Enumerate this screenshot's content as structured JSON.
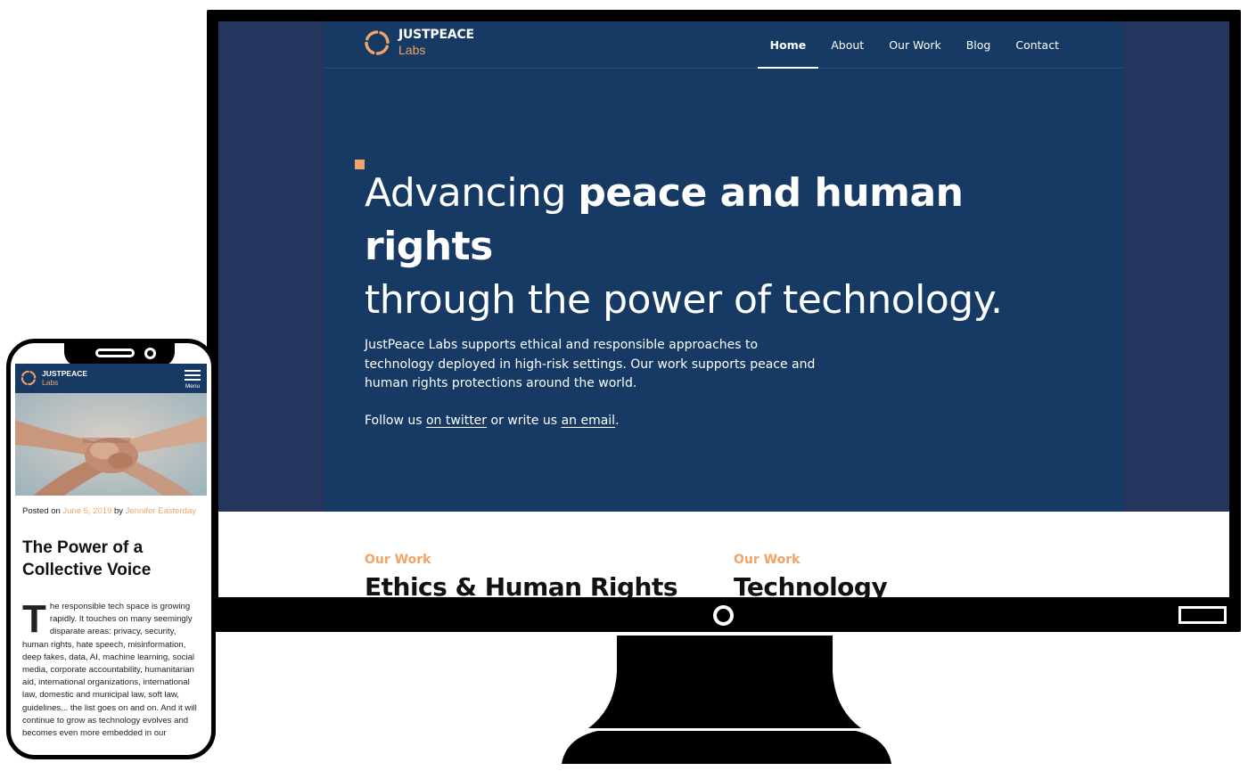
{
  "colors": {
    "navy": "#163a63",
    "accent": "#f0a467",
    "side": "#25365e"
  },
  "desktop": {
    "logo": {
      "top": "JUSTPEACE",
      "bottom": "Labs"
    },
    "nav": [
      {
        "label": "Home",
        "active": true
      },
      {
        "label": "About"
      },
      {
        "label": "Our Work"
      },
      {
        "label": "Blog"
      },
      {
        "label": "Contact"
      }
    ],
    "headline": {
      "part1": "Advancing ",
      "bold": "peace and human rights",
      "part2": "through the power of technology."
    },
    "intro": "JustPeace Labs supports ethical and responsible approaches to technology deployed in high-risk settings. Our work supports peace and human rights protections around the world.",
    "follow": {
      "prefix": "Follow us ",
      "twitter": "on twitter",
      "middle": " or write us ",
      "email": "an email",
      "suffix": "."
    },
    "work": [
      {
        "kicker": "Our Work",
        "title": "Ethics & Human Rights"
      },
      {
        "kicker": "Our Work",
        "title": "Technology"
      }
    ]
  },
  "mobile": {
    "logo": {
      "top": "JUSTPEACE",
      "bottom": "Labs"
    },
    "menu_label": "Menu",
    "meta": {
      "posted_on": "Posted on ",
      "date": "June 5, 2019",
      "by": " by ",
      "author": "Jennifer Easterday"
    },
    "title": "The Power of a Collective Voice",
    "dropcap": "T",
    "body": "he responsible tech space is growing rapidly. It touches on many seemingly disparate areas: privacy, security, human rights, hate speech, misinformation, deep fakes, data, AI, machine learning, social media, corporate accountability, humanitarian aid, international organizations, international law, domestic and municipal law, soft law, guidelines... the list goes on and on. And it will continue to grow as technology evolves and becomes even more embedded in our"
  }
}
